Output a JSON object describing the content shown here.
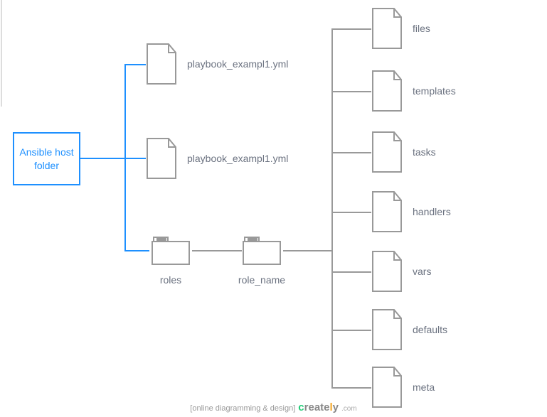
{
  "root": {
    "label": "Ansible host\nfolder"
  },
  "level2": [
    {
      "label": "playbook_exampl1.yml",
      "type": "file"
    },
    {
      "label": "playbook_exampl1.yml",
      "type": "file"
    },
    {
      "label": "roles",
      "type": "folder"
    }
  ],
  "level3": {
    "label": "role_name",
    "type": "folder"
  },
  "level4": [
    {
      "label": "files"
    },
    {
      "label": "templates"
    },
    {
      "label": "tasks"
    },
    {
      "label": "handlers"
    },
    {
      "label": "vars"
    },
    {
      "label": "defaults"
    },
    {
      "label": "meta"
    }
  ],
  "footer": {
    "prefix": "[online diagramming & design]",
    "brand": "creately",
    "suffix": ".com"
  },
  "colors": {
    "outline": "#999999",
    "accent": "#1E90FF",
    "text": "#6b7280"
  }
}
